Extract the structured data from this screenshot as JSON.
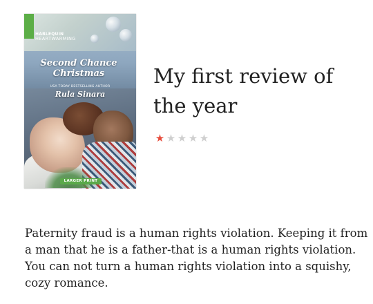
{
  "book": {
    "publisher_line1": "HARLEQUIN",
    "publisher_line2": "HEARTWARMING",
    "title_line1": "Second Chance",
    "title_line2": "Christmas",
    "bestseller_note": "USA TODAY BESTSELLING AUTHOR",
    "author": "Rula Sinara",
    "edition_badge": "LARGER PRINT"
  },
  "review": {
    "title": "My first review of the year",
    "rating": 1,
    "rating_max": 5,
    "body": "Paternity fraud is a human rights violation. Keeping it from a man that he is a father-that is a human rights violation. You can not turn a human rights violation into a squishy, cozy romance."
  },
  "colors": {
    "star_filled": "#e74c3c",
    "star_empty": "#cfcfcf",
    "badge_green": "#5aa94a"
  }
}
